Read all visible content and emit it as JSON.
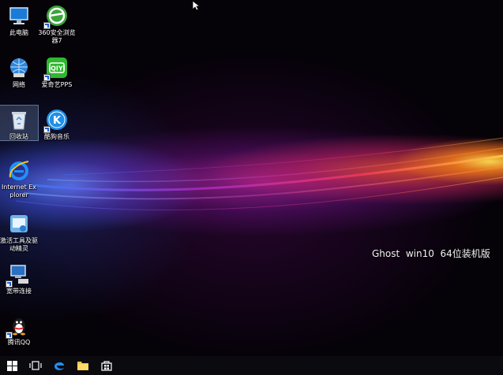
{
  "desktop": {
    "icons": [
      {
        "label": "此电脑",
        "icon": "this-pc-icon",
        "selected": false
      },
      {
        "label": "360安全浏览器7",
        "icon": "360-browser-icon",
        "shortcut": true,
        "selected": false
      },
      {
        "label": "网络",
        "icon": "network-icon",
        "selected": false
      },
      {
        "label": "爱奇艺PPS",
        "icon": "iqiyi-icon",
        "shortcut": true,
        "selected": false
      },
      {
        "label": "回收站",
        "icon": "recycle-bin-icon",
        "selected": true
      },
      {
        "label": "酷狗音乐",
        "icon": "kugou-music-icon",
        "shortcut": true,
        "selected": false
      },
      {
        "label": "Internet Explorer",
        "icon": "internet-explorer-icon",
        "selected": false
      },
      {
        "label": "激活工具及驱动精灵",
        "icon": "activation-tools-icon",
        "selected": false
      },
      {
        "label": "宽带连接",
        "icon": "broadband-connection-icon",
        "shortcut": true,
        "selected": false
      },
      {
        "label": "腾讯QQ",
        "icon": "tencent-qq-icon",
        "shortcut": true,
        "selected": false
      }
    ],
    "watermark": "Ghost  win10  64位装机版"
  },
  "taskbar": {
    "buttons": [
      "start-icon",
      "task-view-icon",
      "edge-icon",
      "file-explorer-icon",
      "store-icon"
    ]
  },
  "colors": {
    "taskbar": "#0a0a0f",
    "wallpaper_base": "#050208",
    "accent_blue": "#1e90ff"
  }
}
